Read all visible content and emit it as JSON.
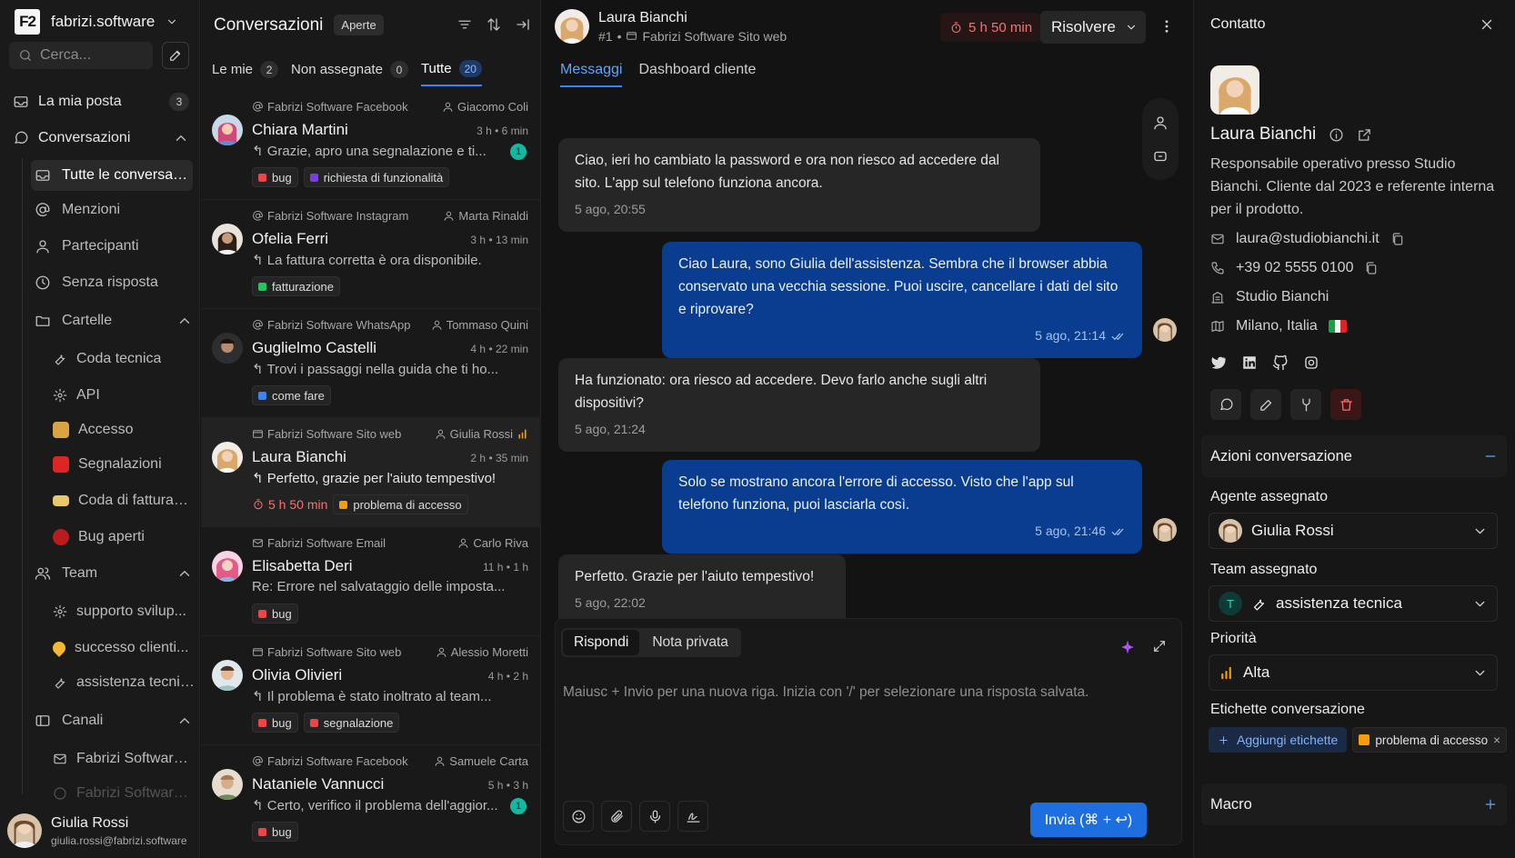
{
  "workspace": {
    "logo": "F2",
    "name": "fabrizi.software"
  },
  "search": {
    "placeholder": "Cerca..."
  },
  "nav": {
    "inbox": {
      "label": "La mia posta",
      "count": "3"
    },
    "conversations": {
      "label": "Conversazioni"
    },
    "all": "Tutte le conversazioni",
    "mentions": "Menzioni",
    "participants": "Partecipanti",
    "unanswered": "Senza risposta",
    "folders": {
      "label": "Cartelle",
      "items": [
        "Coda tecnica",
        "API",
        "Accesso",
        "Segnalazioni",
        "Coda di fatturazione",
        "Bug aperti"
      ]
    },
    "team": {
      "label": "Team",
      "items": [
        "supporto svilup...",
        "successo clienti...",
        "assistenza tecnica..."
      ]
    },
    "channels": {
      "label": "Canali",
      "items": [
        "Fabrizi Software E...",
        "Fabrizi Software Fa..."
      ]
    }
  },
  "current_user": {
    "name": "Giulia Rossi",
    "email": "giulia.rossi@fabrizi.software"
  },
  "list": {
    "title": "Conversazioni",
    "status": "Aperte",
    "tabs": [
      {
        "label": "Le mie",
        "count": "2"
      },
      {
        "label": "Non assegnate",
        "count": "0"
      },
      {
        "label": "Tutte",
        "count": "20"
      }
    ],
    "items": [
      {
        "inbox": "Fabrizi Software Facebook",
        "agent": "Giacomo Coli",
        "name": "Chiara Martini",
        "time": "3 h • 6 min",
        "preview": "Grazie, apro una segnalazione e ti...",
        "unread": "1",
        "tags": [
          {
            "label": "bug",
            "color": "#ef4444"
          },
          {
            "label": "richiesta di funzionalità",
            "color": "#7c3aed"
          }
        ]
      },
      {
        "inbox": "Fabrizi Software Instagram",
        "agent": "Marta Rinaldi",
        "name": "Ofelia Ferri",
        "time": "3 h • 13 min",
        "preview": "La fattura corretta è ora disponibile.",
        "tags": [
          {
            "label": "fatturazione",
            "color": "#22c55e"
          }
        ]
      },
      {
        "inbox": "Fabrizi Software WhatsApp",
        "agent": "Tommaso Quini",
        "name": "Guglielmo Castelli",
        "time": "4 h • 22 min",
        "preview": "Trovi i passaggi nella guida che ti ho...",
        "tags": [
          {
            "label": "come fare",
            "color": "#3b82f6"
          }
        ]
      },
      {
        "inbox": "Fabrizi Software Sito web",
        "agent": "Giulia Rossi",
        "name": "Laura Bianchi",
        "time": "2 h • 35 min",
        "preview": "Perfetto, grazie per l'aiuto tempestivo!",
        "sla": "5 h 50 min",
        "tags": [
          {
            "label": "problema di accesso",
            "color": "#f59e0b"
          }
        ]
      },
      {
        "inbox": "Fabrizi Software Email",
        "agent": "Carlo Riva",
        "name": "Elisabetta Deri",
        "time": "11 h • 1 h",
        "preview": "Re: Errore nel salvataggio delle imposta...",
        "tags": [
          {
            "label": "bug",
            "color": "#ef4444"
          }
        ]
      },
      {
        "inbox": "Fabrizi Software Sito web",
        "agent": "Alessio Moretti",
        "name": "Olivia Olivieri",
        "time": "4 h • 2 h",
        "preview": "Il problema è stato inoltrato al team...",
        "tags": [
          {
            "label": "bug",
            "color": "#ef4444"
          },
          {
            "label": "segnalazione",
            "color": "#ef4444"
          }
        ]
      },
      {
        "inbox": "Fabrizi Software Facebook",
        "agent": "Samuele Carta",
        "name": "Nataniele Vannucci",
        "time": "5 h • 3 h",
        "preview": "Certo, verifico il problema dell'aggior...",
        "unread": "1",
        "tags": [
          {
            "label": "bug",
            "color": "#ef4444"
          }
        ]
      }
    ]
  },
  "chat": {
    "contact_name": "Laura Bianchi",
    "conv_id": "#1",
    "inbox": "Fabrizi Software Sito web",
    "sla": "5 h 50 min",
    "resolve_label": "Risolvere",
    "tabs": [
      "Messaggi",
      "Dashboard cliente"
    ],
    "messages": [
      {
        "dir": "in",
        "text": "Ciao, ieri ho cambiato la password e ora non riesco ad accedere dal sito. L'app sul telefono funziona ancora.",
        "time": "5 ago, 20:55"
      },
      {
        "dir": "out",
        "text": "Ciao Laura, sono Giulia dell'assistenza. Sembra che il browser abbia conservato una vecchia sessione. Puoi uscire, cancellare i dati del sito e riprovare?",
        "time": "5 ago, 21:14"
      },
      {
        "dir": "in",
        "text": "Ha funzionato: ora riesco ad accedere. Devo farlo anche sugli altri dispositivi?",
        "time": "5 ago, 21:24"
      },
      {
        "dir": "out",
        "text": "Solo se mostrano ancora l'errore di accesso. Visto che l'app sul telefono funziona, puoi lasciarla così.",
        "time": "5 ago, 21:46"
      },
      {
        "dir": "in",
        "text": "Perfetto. Grazie per l'aiuto tempestivo!",
        "time": "5 ago, 22:02"
      }
    ],
    "composer": {
      "reply_tab": "Rispondi",
      "note_tab": "Nota privata",
      "placeholder": "Maiusc + Invio per una nuova riga. Inizia con '/' per selezionare una risposta salvata.",
      "send_label": "Invia (⌘ + ↩)"
    }
  },
  "contact": {
    "header": "Contatto",
    "name": "Laura Bianchi",
    "bio": "Responsabile operativo presso Studio Bianchi. Cliente dal 2023 e referente interna per il prodotto.",
    "email": "laura@studiobianchi.it",
    "phone": "+39 02 5555 0100",
    "company": "Studio Bianchi",
    "location": "Milano, Italia",
    "actions_title": "Azioni conversazione",
    "assigned_agent_label": "Agente assegnato",
    "assigned_agent": "Giulia Rossi",
    "assigned_team_label": "Team assegnato",
    "assigned_team_initial": "T",
    "assigned_team": "assistenza tecnica",
    "priority_label": "Priorità",
    "priority": "Alta",
    "labels_title": "Etichette conversazione",
    "add_label": "Aggiungi etichette",
    "labels": [
      {
        "label": "problema di accesso",
        "color": "#f59e0b"
      }
    ],
    "macro_title": "Macro"
  },
  "colors": {
    "accent": "#3b82f6",
    "sla": "#f87171",
    "outgoing": "#0a3d8f"
  }
}
